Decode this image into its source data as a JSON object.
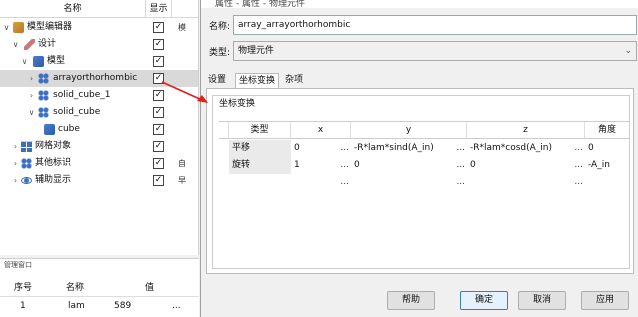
{
  "tree": {
    "header": {
      "name": "名称",
      "visible": "显示",
      "col3": ""
    },
    "rows": [
      {
        "label": "模型编辑器",
        "col3": "模"
      },
      {
        "label": "设计",
        "col3": ""
      },
      {
        "label": "模型",
        "col3": ""
      },
      {
        "label": "arrayorthorhombic",
        "col3": ""
      },
      {
        "label": "solid_cube_1",
        "col3": ""
      },
      {
        "label": "solid_cube",
        "col3": ""
      },
      {
        "label": "cube",
        "col3": ""
      },
      {
        "label": "网格对象",
        "col3": ""
      },
      {
        "label": "其他标识",
        "col3": "自"
      },
      {
        "label": "辅助显示",
        "col3": "早"
      }
    ]
  },
  "bottom_panel": {
    "title": "管理窗口",
    "headers": [
      "序号",
      "名称",
      "值"
    ],
    "row": {
      "index": "1",
      "name": "lam",
      "value": "589",
      "extra": "..."
    }
  },
  "dialog": {
    "title": "属性 - 属性 - 物理元件",
    "name_label": "名称:",
    "name_value": "array_arrayorthorhombic",
    "type_label": "类型:",
    "type_value": "物理元件",
    "tabs": [
      "设置",
      "坐标变换",
      "杂项"
    ],
    "active_tab": "坐标变换",
    "group_title": "坐标变换",
    "grid": {
      "headers": [
        "类型",
        "x",
        "y",
        "z",
        "角度"
      ],
      "rows": [
        {
          "type": "平移",
          "x": "0",
          "y": "-R*lam*sind(A_in)",
          "z": "-R*lam*cosd(A_in)",
          "angle": "0"
        },
        {
          "type": "旋转",
          "x": "1",
          "y": "0",
          "z": "0",
          "angle": "-A_in"
        },
        {
          "type": "",
          "x": "",
          "y": "",
          "z": "",
          "angle": ""
        }
      ],
      "ellipsis": "..."
    },
    "buttons": {
      "help": "帮助",
      "ok": "确定",
      "cancel": "取消",
      "apply": "应用"
    }
  },
  "colors": {
    "selection": "#d9d9d9",
    "arrow": "#e0201a",
    "default_button_border": "#3c7fb1"
  },
  "icons": [
    "model-editor-icon",
    "design-icon",
    "model-icon",
    "array-icon",
    "solid-icon",
    "cube-icon",
    "mesh-icon",
    "tag-icon",
    "eye-icon"
  ]
}
